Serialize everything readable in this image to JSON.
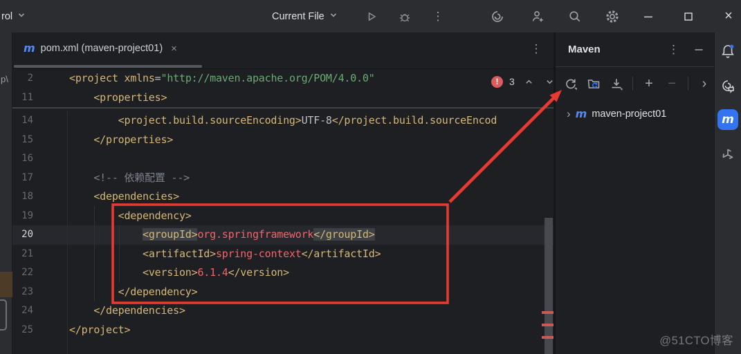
{
  "titlebar": {
    "project_widget": "rol",
    "run_config": "Current File"
  },
  "tabbar": {
    "active_tab": "pom.xml (maven-project01)"
  },
  "editor": {
    "inspection_count": "3",
    "lines": [
      {
        "num": "2",
        "sticky": true,
        "segs": [
          [
            "tag",
            "<project"
          ],
          [
            "txt",
            " "
          ],
          [
            "attr",
            "xmlns"
          ],
          [
            "op",
            "="
          ],
          [
            "str",
            "\"http://maven.apache.org/POM/4.0.0\""
          ]
        ]
      },
      {
        "num": "11",
        "sticky": true,
        "segs": [
          [
            "tag",
            "    <properties>"
          ]
        ]
      },
      {
        "num": "14",
        "segs": [
          [
            "tag",
            "        <project.build.sourceEncoding>"
          ],
          [
            "txt",
            "UTF-8"
          ],
          [
            "tag",
            "</project.build.sourceEncod"
          ]
        ]
      },
      {
        "num": "15",
        "segs": [
          [
            "tag",
            "    </properties>"
          ]
        ]
      },
      {
        "num": "16",
        "segs": []
      },
      {
        "num": "17",
        "segs": [
          [
            "com",
            "    <!-- 依赖配置 -->"
          ]
        ]
      },
      {
        "num": "18",
        "segs": [
          [
            "tag",
            "    <dependencies>"
          ]
        ]
      },
      {
        "num": "19",
        "segs": [
          [
            "tag",
            "        <dependency>"
          ]
        ]
      },
      {
        "num": "20",
        "current": true,
        "segs": [
          [
            "txt",
            "            "
          ],
          [
            "taghl",
            "<groupId>"
          ],
          [
            "err",
            "org.springframework"
          ],
          [
            "taghl",
            "</groupId>"
          ]
        ]
      },
      {
        "num": "21",
        "segs": [
          [
            "txt",
            "            "
          ],
          [
            "tag",
            "<artifactId>"
          ],
          [
            "err",
            "spring-context"
          ],
          [
            "tag",
            "</artifactId>"
          ]
        ]
      },
      {
        "num": "22",
        "segs": [
          [
            "txt",
            "            "
          ],
          [
            "tag",
            "<version>"
          ],
          [
            "err",
            "6.1.4"
          ],
          [
            "tag",
            "</version>"
          ]
        ]
      },
      {
        "num": "23",
        "segs": [
          [
            "tag",
            "        </dependency>"
          ]
        ]
      },
      {
        "num": "24",
        "segs": [
          [
            "tag",
            "    </dependencies>"
          ]
        ]
      },
      {
        "num": "25",
        "segs": [
          [
            "tag",
            "</project>"
          ]
        ]
      }
    ]
  },
  "maven": {
    "title": "Maven",
    "tree_item": "maven-project01"
  },
  "left_fragment": "p\\",
  "watermark": "@51CTO博客",
  "glyphs": {
    "plus": "+",
    "minus": "−",
    "chevron_right": "›",
    "kebab": "⋮",
    "close": "×",
    "maven_m": "m",
    "bang": "!"
  },
  "icons": {
    "titlebar": [
      "play",
      "debug",
      "more",
      "ai-assistant",
      "add-user",
      "search",
      "settings",
      "minimize",
      "maximize",
      "close"
    ],
    "maven_toolbar": [
      "reload-all",
      "sync-folder",
      "download-sources",
      "add",
      "remove",
      "chevron-right"
    ],
    "right_strip": [
      "notifications",
      "ai-chat",
      "maven",
      "build-tools"
    ]
  },
  "colors": {
    "accent": "#3574f0",
    "annotation_red": "#e93a31",
    "error_text": "#f2656a",
    "tag": "#d5b778",
    "string": "#6aab73",
    "panel_bg": "#2b2d30",
    "editor_bg": "#1e1f22"
  }
}
